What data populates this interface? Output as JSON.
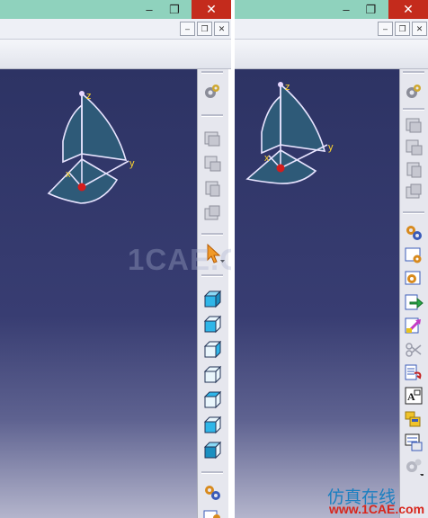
{
  "left_window": {
    "title_buttons": {
      "minimize": "–",
      "restore": "❐",
      "close": "✕"
    },
    "mdi_buttons": {
      "minimize": "–",
      "restore": "❐",
      "close": "✕"
    },
    "compass": {
      "z_label": "z",
      "y_label": "y",
      "x_label": "x"
    }
  },
  "right_window": {
    "title_buttons": {
      "minimize": "–",
      "restore": "❐",
      "close": "✕"
    },
    "mdi_buttons": {
      "minimize": "–",
      "restore": "❐",
      "close": "✕"
    },
    "compass": {
      "z_label": "z",
      "y_label": "y",
      "x_label": "x"
    }
  },
  "left_toolbar": {
    "icons": [
      "knowledge-gears-icon",
      "insert-body-icon",
      "insert-body-alt-icon",
      "assemble-body-icon",
      "sketch-body-icon",
      "select-arrow-icon",
      "iso-view-icon",
      "front-view-icon",
      "back-view-icon",
      "left-view-icon",
      "right-view-icon",
      "top-view-icon",
      "bottom-view-icon",
      "parameters-gears-icon",
      "formula-icon"
    ]
  },
  "right_toolbar": {
    "icons": [
      "knowledge-gears-icon",
      "insert-body-icon",
      "insert-body-alt-icon",
      "assemble-body-icon",
      "sketch-body-icon",
      "formula-gears-icon",
      "rule-icon",
      "check-icon",
      "export-icon",
      "import-icon",
      "reaction-icon",
      "table-icon",
      "text-icon",
      "catalog-icon",
      "design-table-icon",
      "settings-gears-icon"
    ]
  },
  "watermark": "1CAE.COM",
  "logo": {
    "text": "仿真在线",
    "url": "www.1CAE.com"
  },
  "colors": {
    "titlebar": "#8fd2bd",
    "close_button": "#c42b1c",
    "viewport_top": "#2d3364",
    "viewport_bottom": "#b4b5cc",
    "compass_fill": "#2e5a78",
    "axis_label": "#ffd52e",
    "origin_dot": "#d41c1c"
  }
}
